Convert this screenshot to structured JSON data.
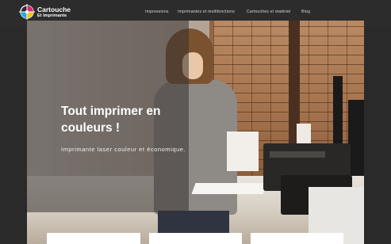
{
  "header": {
    "logo_title": "Cartouche",
    "logo_subtitle": "Et Imprimante",
    "nav": [
      {
        "label": "Impressions"
      },
      {
        "label": "Imprimantes et multifonctions"
      },
      {
        "label": "Cartouches et matériel"
      },
      {
        "label": "Blog"
      }
    ]
  },
  "hero": {
    "title": "Tout imprimer en couleurs !",
    "subtitle": "Imprimante laser couleur et économique."
  },
  "colors": {
    "header_bg": "#2c2c2c",
    "logo_cyan": "#2aa8d8",
    "logo_magenta": "#d6287a",
    "logo_yellow": "#f2c21b",
    "text_white": "#ffffff"
  }
}
